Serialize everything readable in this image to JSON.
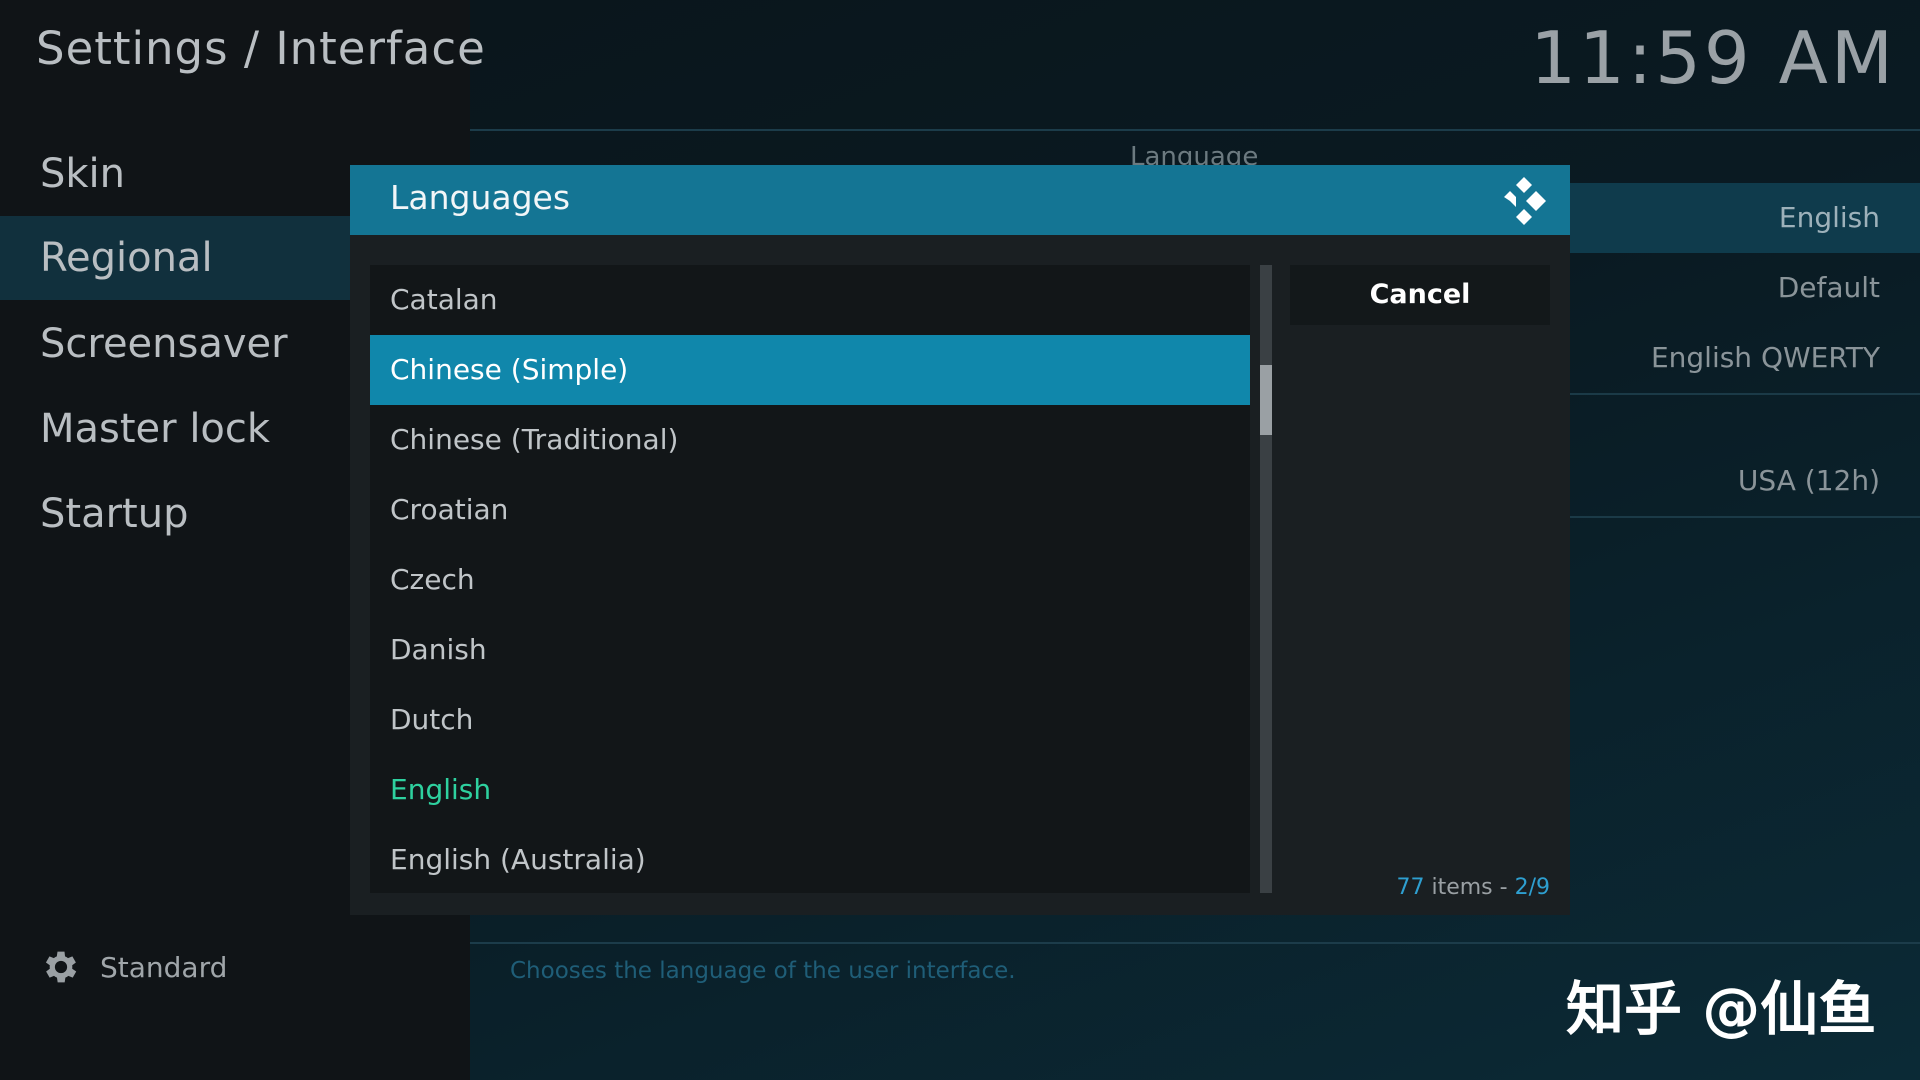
{
  "header": {
    "title": "Settings / Interface",
    "clock": "11:59 AM"
  },
  "sidebar": {
    "items": [
      {
        "label": "Skin",
        "selected": false
      },
      {
        "label": "Regional",
        "selected": true
      },
      {
        "label": "Screensaver",
        "selected": false
      },
      {
        "label": "Master lock",
        "selected": false
      },
      {
        "label": "Startup",
        "selected": false
      }
    ],
    "settings_level": {
      "icon": "gear-icon",
      "label": "Standard"
    }
  },
  "settings_panel": {
    "heading": "Language",
    "values": [
      {
        "value": "English",
        "highlighted": true
      },
      {
        "value": "Default",
        "highlighted": false
      },
      {
        "value": "English QWERTY",
        "highlighted": false
      },
      {
        "value": "USA (12h)",
        "highlighted": false
      }
    ],
    "description": "Chooses the language of the user interface."
  },
  "dialog": {
    "title": "Languages",
    "logo_icon": "kodi-logo-icon",
    "items": [
      {
        "label": "Catalan",
        "state": "normal"
      },
      {
        "label": "Chinese (Simple)",
        "state": "selected"
      },
      {
        "label": "Chinese (Traditional)",
        "state": "normal"
      },
      {
        "label": "Croatian",
        "state": "normal"
      },
      {
        "label": "Czech",
        "state": "normal"
      },
      {
        "label": "Danish",
        "state": "normal"
      },
      {
        "label": "Dutch",
        "state": "normal"
      },
      {
        "label": "English",
        "state": "current"
      },
      {
        "label": "English (Australia)",
        "state": "normal"
      }
    ],
    "cancel_label": "Cancel",
    "item_count": "77",
    "items_word": "items",
    "separator": "-",
    "page": "2/9",
    "scroll_position": 0.16,
    "colors": {
      "accent": "#147594",
      "selected": "#1087ab",
      "current": "#2ed19f"
    }
  },
  "watermark": "知乎 @仙鱼"
}
